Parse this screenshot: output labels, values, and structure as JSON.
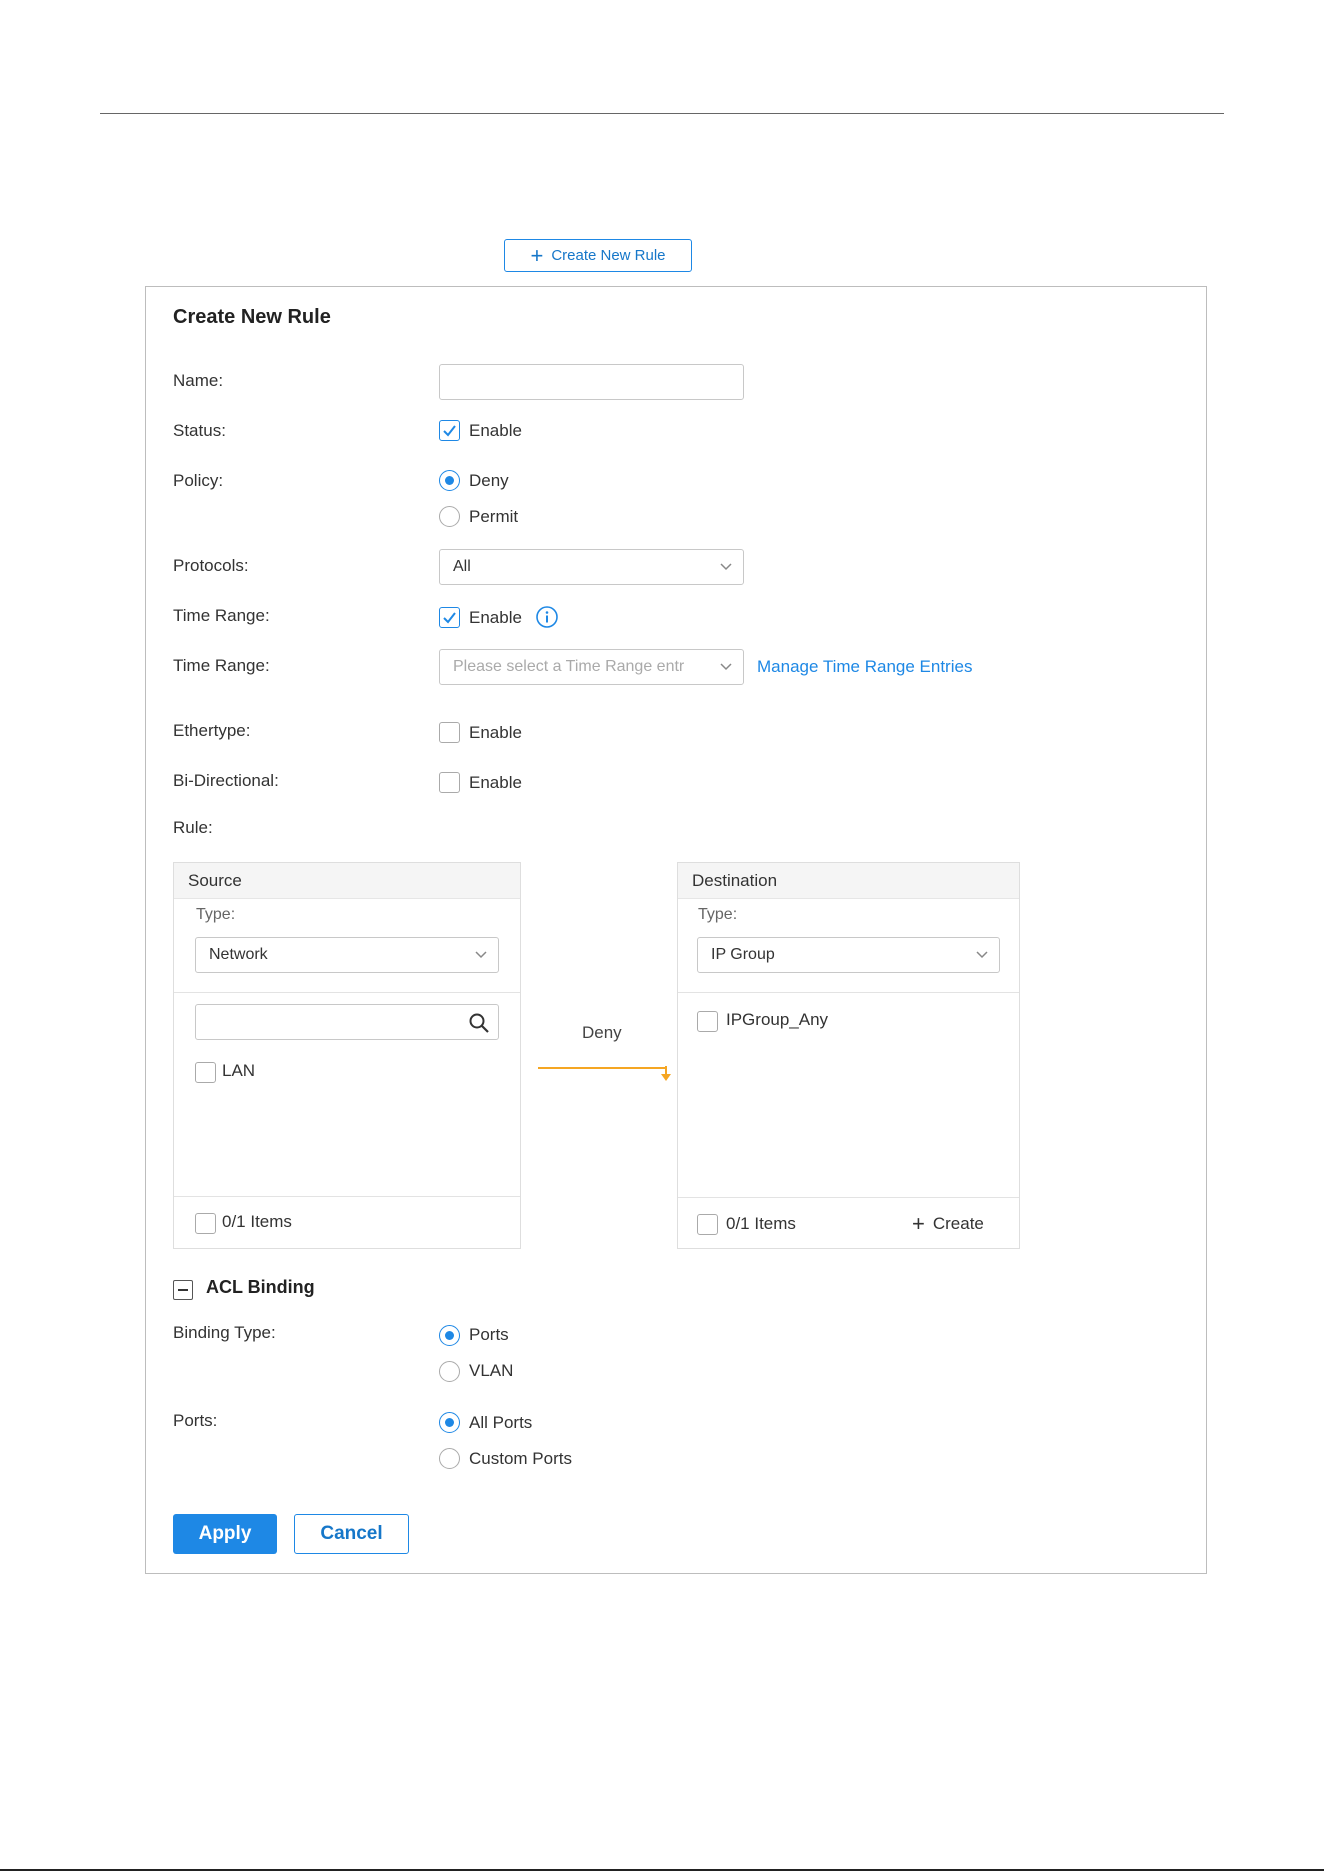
{
  "top_button": {
    "label": "Create New Rule"
  },
  "form": {
    "title": "Create New Rule",
    "name": {
      "label": "Name:",
      "value": ""
    },
    "status": {
      "label": "Status:",
      "option": "Enable",
      "checked": true
    },
    "policy": {
      "label": "Policy:",
      "options": [
        "Deny",
        "Permit"
      ],
      "selected": "Deny"
    },
    "protocols": {
      "label": "Protocols:",
      "value": "All"
    },
    "time_range_toggle": {
      "label": "Time Range:",
      "option": "Enable",
      "checked": true
    },
    "time_range": {
      "label": "Time Range:",
      "placeholder": "Please select a Time Range entr",
      "link": "Manage Time Range Entries"
    },
    "ethertype": {
      "label": "Ethertype:",
      "option": "Enable",
      "checked": false
    },
    "bi_directional": {
      "label": "Bi-Directional:",
      "option": "Enable",
      "checked": false
    },
    "rule_label": "Rule:"
  },
  "source": {
    "title": "Source",
    "type_label": "Type:",
    "type_value": "Network",
    "items": [
      "LAN"
    ],
    "footer": "0/1 Items"
  },
  "action": {
    "label": "Deny"
  },
  "destination": {
    "title": "Destination",
    "type_label": "Type:",
    "type_value": "IP Group",
    "items": [
      "IPGroup_Any"
    ],
    "footer": "0/1 Items",
    "create_label": "Create"
  },
  "acl_binding": {
    "title": "ACL Binding",
    "binding_type": {
      "label": "Binding Type:",
      "options": [
        "Ports",
        "VLAN"
      ],
      "selected": "Ports"
    },
    "ports": {
      "label": "Ports:",
      "options": [
        "All Ports",
        "Custom Ports"
      ],
      "selected": "All Ports"
    }
  },
  "buttons": {
    "apply": "Apply",
    "cancel": "Cancel"
  },
  "colors": {
    "accent": "#1e88e5",
    "arrow": "#f5a623"
  }
}
